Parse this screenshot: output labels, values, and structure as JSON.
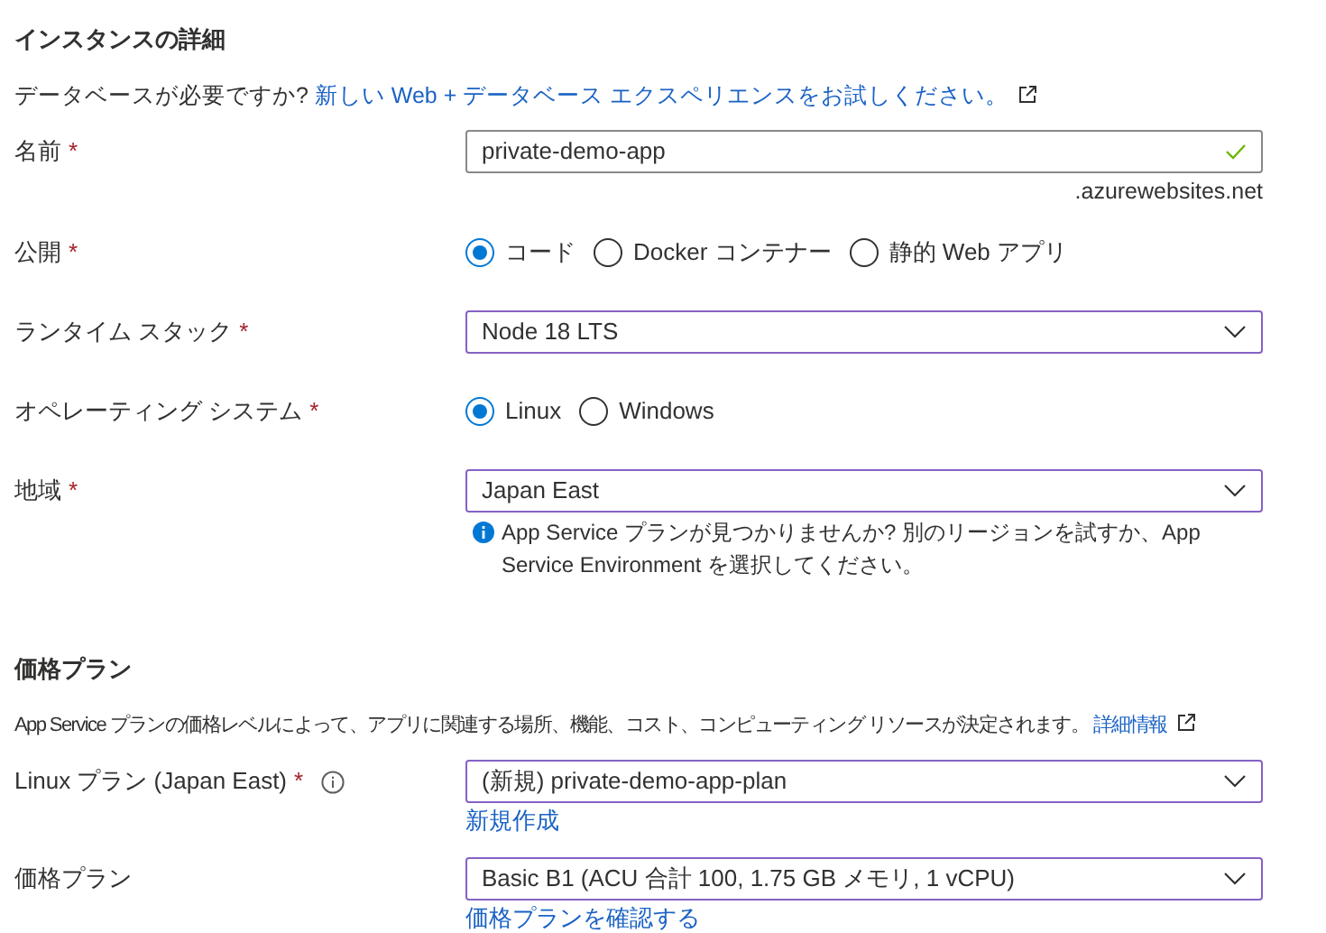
{
  "sections": [
    {
      "title": "インスタンスの詳細",
      "intro": {
        "text": "データベースが必要ですか?",
        "link": "新しい Web + データベース エクスペリエンスをお試しください。"
      },
      "fields": [
        {
          "kind": "text",
          "label": "名前",
          "required_mark": "*",
          "value": "private-demo-app",
          "valid": true,
          "suffix": ".azurewebsites.net"
        },
        {
          "kind": "radio",
          "label": "公開",
          "required_mark": "*",
          "options": [
            {
              "label": "コード",
              "selected": true
            },
            {
              "label": "Docker コンテナー",
              "selected": false
            },
            {
              "label": "静的 Web アプリ",
              "selected": false
            }
          ]
        },
        {
          "kind": "select",
          "label": "ランタイム スタック",
          "required_mark": "*",
          "value": "Node 18 LTS"
        },
        {
          "kind": "radio",
          "label": "オペレーティング システム",
          "required_mark": "*",
          "options": [
            {
              "label": "Linux",
              "selected": true
            },
            {
              "label": "Windows",
              "selected": false
            }
          ]
        },
        {
          "kind": "select",
          "label": "地域",
          "required_mark": "*",
          "value": "Japan East",
          "info": "App Service プランが見つかりませんか? 別のリージョンを試すか、App Service Environment を選択してください。"
        }
      ]
    },
    {
      "title": "価格プラン",
      "intro": {
        "text": "App Service プランの価格レベルによって、アプリに関連する場所、機能、コスト、コンピューティング リソースが決定されます。",
        "link": "詳細情報"
      },
      "fields": [
        {
          "kind": "select",
          "label": "Linux プラン (Japan East)",
          "required_mark": "*",
          "help_icon": true,
          "value": "(新規) private-demo-app-plan",
          "link": "新規作成"
        },
        {
          "kind": "select",
          "label": "価格プラン",
          "value": "Basic B1 (ACU 合計 100, 1.75 GB メモリ, 1 vCPU)",
          "link": "価格プランを確認する"
        }
      ]
    }
  ]
}
